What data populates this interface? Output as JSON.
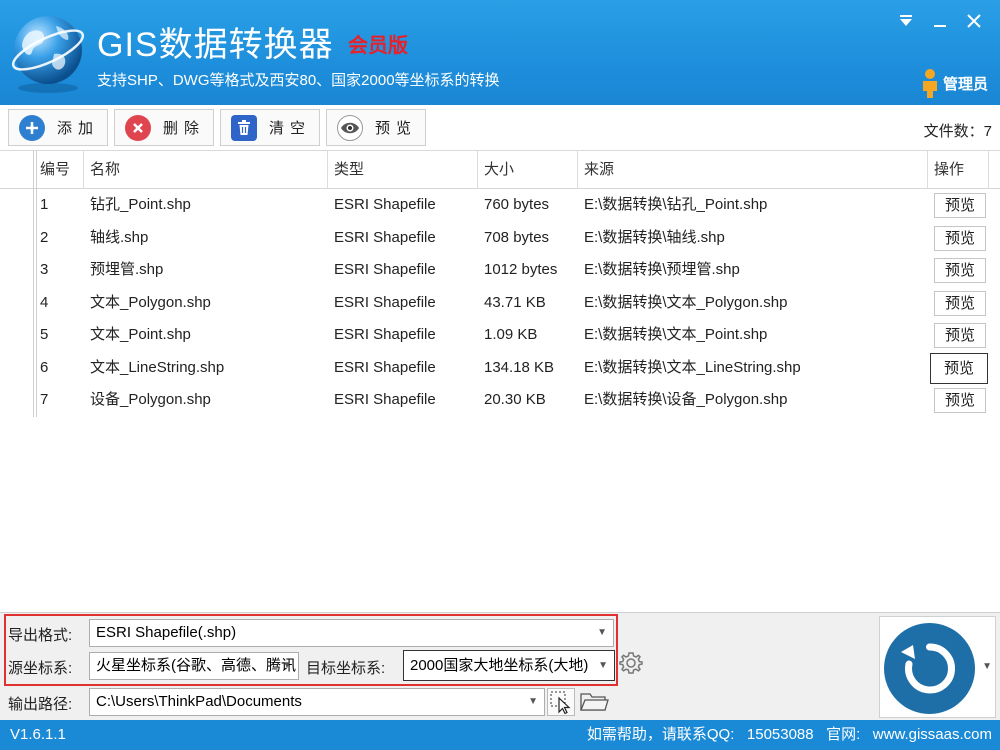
{
  "window": {
    "title": "GIS数据转换器",
    "edition": "会员版",
    "subtitle": "支持SHP、DWG等格式及西安80、国家2000等坐标系的转换",
    "user": "管理员"
  },
  "toolbar": {
    "add_label": "添加",
    "delete_label": "删除",
    "clear_label": "清空",
    "preview_label": "预览",
    "file_count_label": "文件数：",
    "file_count": "7"
  },
  "table": {
    "headers": [
      "编号",
      "名称",
      "类型",
      "大小",
      "来源",
      "操作"
    ],
    "rows": [
      {
        "id": "1",
        "name": "钻孔_Point.shp",
        "type": "ESRI Shapefile",
        "size": "760 bytes",
        "source": "E:\\数据转换\\钻孔_Point.shp",
        "action": "预览"
      },
      {
        "id": "2",
        "name": "轴线.shp",
        "type": "ESRI Shapefile",
        "size": "708 bytes",
        "source": "E:\\数据转换\\轴线.shp",
        "action": "预览"
      },
      {
        "id": "3",
        "name": "预埋管.shp",
        "type": "ESRI Shapefile",
        "size": "1012 bytes",
        "source": "E:\\数据转换\\预埋管.shp",
        "action": "预览"
      },
      {
        "id": "4",
        "name": "文本_Polygon.shp",
        "type": "ESRI Shapefile",
        "size": "43.71 KB",
        "source": "E:\\数据转换\\文本_Polygon.shp",
        "action": "预览"
      },
      {
        "id": "5",
        "name": "文本_Point.shp",
        "type": "ESRI Shapefile",
        "size": "1.09 KB",
        "source": "E:\\数据转换\\文本_Point.shp",
        "action": "预览"
      },
      {
        "id": "6",
        "name": "文本_LineString.shp",
        "type": "ESRI Shapefile",
        "size": "134.18 KB",
        "source": "E:\\数据转换\\文本_LineString.shp",
        "action": "预览"
      },
      {
        "id": "7",
        "name": "设备_Polygon.shp",
        "type": "ESRI Shapefile",
        "size": "20.30 KB",
        "source": "E:\\数据转换\\设备_Polygon.shp",
        "action": "预览"
      }
    ]
  },
  "settings": {
    "export_format_label": "导出格式:",
    "export_format_value": "ESRI Shapefile(.shp)",
    "source_crs_label": "源坐标系:",
    "source_crs_value": "火星坐标系(谷歌、高德、腾讯",
    "target_crs_label": "目标坐标系:",
    "target_crs_value": "2000国家大地坐标系(大地)",
    "output_path_label": "输出路径:",
    "output_path_value": "C:\\Users\\ThinkPad\\Documents"
  },
  "status": {
    "version": "V1.6.1.1",
    "help_text": "如需帮助，请联系QQ:   15053088   官网:   www.gissaas.com"
  },
  "colors": {
    "header_blue": "#1e8fdc",
    "edition_red": "#e8202a",
    "status_blue": "#1a8ad6",
    "highlight_red": "#e03030",
    "convert_button": "#1e6fa8"
  },
  "icons": {
    "add": "plus-icon",
    "delete": "close-icon",
    "clear": "trash-icon",
    "preview": "eye-icon",
    "convert": "refresh-icon",
    "settings": "gear-icon",
    "pick": "cursor-select-icon",
    "folder": "folder-icon",
    "user": "user-icon"
  }
}
